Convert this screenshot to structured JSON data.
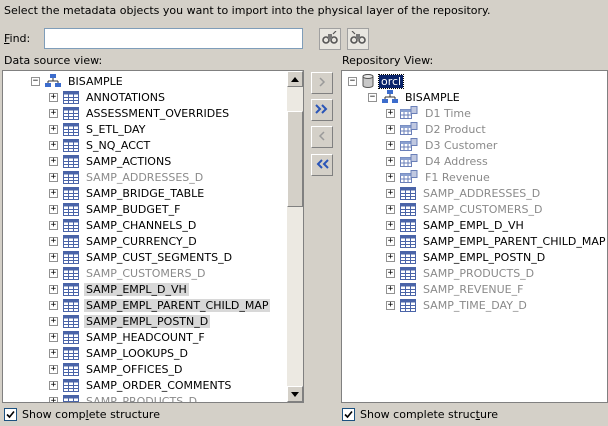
{
  "instructions": "Select the metadata objects you want to import into the physical layer of the repository.",
  "find": {
    "label_prefix": "",
    "label_accel": "F",
    "label_rest": "ind:",
    "value": ""
  },
  "data_source_view": {
    "label": "Data source view:",
    "root": "BISAMPLE",
    "items": [
      {
        "label": "ANNOTATIONS",
        "grey": false,
        "selected": false
      },
      {
        "label": "ASSESSMENT_OVERRIDES",
        "grey": false,
        "selected": false
      },
      {
        "label": "S_ETL_DAY",
        "grey": false,
        "selected": false
      },
      {
        "label": "S_NQ_ACCT",
        "grey": false,
        "selected": false
      },
      {
        "label": "SAMP_ACTIONS",
        "grey": false,
        "selected": false
      },
      {
        "label": "SAMP_ADDRESSES_D",
        "grey": true,
        "selected": false
      },
      {
        "label": "SAMP_BRIDGE_TABLE",
        "grey": false,
        "selected": false
      },
      {
        "label": "SAMP_BUDGET_F",
        "grey": false,
        "selected": false
      },
      {
        "label": "SAMP_CHANNELS_D",
        "grey": false,
        "selected": false
      },
      {
        "label": "SAMP_CURRENCY_D",
        "grey": false,
        "selected": false
      },
      {
        "label": "SAMP_CUST_SEGMENTS_D",
        "grey": false,
        "selected": false
      },
      {
        "label": "SAMP_CUSTOMERS_D",
        "grey": true,
        "selected": false
      },
      {
        "label": "SAMP_EMPL_D_VH",
        "grey": false,
        "selected": true
      },
      {
        "label": "SAMP_EMPL_PARENT_CHILD_MAP",
        "grey": false,
        "selected": true
      },
      {
        "label": "SAMP_EMPL_POSTN_D",
        "grey": false,
        "selected": true
      },
      {
        "label": "SAMP_HEADCOUNT_F",
        "grey": false,
        "selected": false
      },
      {
        "label": "SAMP_LOOKUPS_D",
        "grey": false,
        "selected": false
      },
      {
        "label": "SAMP_OFFICES_D",
        "grey": false,
        "selected": false
      },
      {
        "label": "SAMP_ORDER_COMMENTS",
        "grey": false,
        "selected": false
      },
      {
        "label": "SAMP_PRODUCTS_D",
        "grey": true,
        "selected": false
      }
    ],
    "show_structure": {
      "prefix": "Show comp",
      "accel": "l",
      "rest": "ete structure",
      "checked": true
    }
  },
  "repository_view": {
    "label": "Repository View:",
    "root": "orcl",
    "schema": "BISAMPLE",
    "items": [
      {
        "label": "D1 Time",
        "grey": true,
        "kind": "cube"
      },
      {
        "label": "D2 Product",
        "grey": true,
        "kind": "cube"
      },
      {
        "label": "D3 Customer",
        "grey": true,
        "kind": "cube"
      },
      {
        "label": "D4 Address",
        "grey": true,
        "kind": "cube"
      },
      {
        "label": "F1 Revenue",
        "grey": true,
        "kind": "cube"
      },
      {
        "label": "SAMP_ADDRESSES_D",
        "grey": true,
        "kind": "table"
      },
      {
        "label": "SAMP_CUSTOMERS_D",
        "grey": true,
        "kind": "table"
      },
      {
        "label": "SAMP_EMPL_D_VH",
        "grey": false,
        "kind": "table"
      },
      {
        "label": "SAMP_EMPL_PARENT_CHILD_MAP",
        "grey": false,
        "kind": "table"
      },
      {
        "label": "SAMP_EMPL_POSTN_D",
        "grey": false,
        "kind": "table"
      },
      {
        "label": "SAMP_PRODUCTS_D",
        "grey": true,
        "kind": "table"
      },
      {
        "label": "SAMP_REVENUE_F",
        "grey": true,
        "kind": "table"
      },
      {
        "label": "SAMP_TIME_DAY_D",
        "grey": true,
        "kind": "table"
      }
    ],
    "show_structure": {
      "prefix": "Show complete struc",
      "accel": "t",
      "rest": "ure",
      "checked": true
    }
  },
  "icons": {
    "find_next": "binoculars-icon",
    "find_prev": "binoculars-back-icon",
    "import_one": "chevron-right-icon",
    "import_all": "double-chevron-right-icon",
    "remove_one": "chevron-left-icon",
    "remove_all": "double-chevron-left-icon"
  },
  "colors": {
    "dialog_bg": "#d4d0c8",
    "table_icon": "#4a64a8",
    "selection_bg": "#d8d8d8",
    "focus_bg": "#0a246a"
  }
}
